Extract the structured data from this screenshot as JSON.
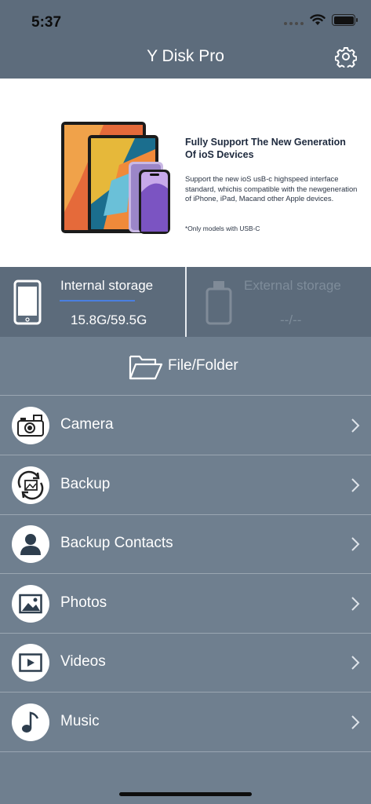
{
  "status_bar": {
    "time": "5:37"
  },
  "header": {
    "title": "Y Disk Pro"
  },
  "banner": {
    "heading": "Fully Support The New Generation Of ioS Devices",
    "body": "Support the new ioS usB-c highspeed interface standard, whichis compatible with the newgeneration of iPhone, iPad, Macand other Apple devices.",
    "note": "*Only models with USB-C"
  },
  "storage": {
    "internal": {
      "label": "Internal storage",
      "value": "15.8G/59.5G"
    },
    "external": {
      "label": "External storage",
      "value": "--/--"
    }
  },
  "file_folder": {
    "label": "File/Folder"
  },
  "menu": [
    {
      "label": "Camera",
      "icon": "camera-icon"
    },
    {
      "label": "Backup",
      "icon": "backup-icon"
    },
    {
      "label": "Backup Contacts",
      "icon": "contact-icon"
    },
    {
      "label": "Photos",
      "icon": "photo-icon"
    },
    {
      "label": "Videos",
      "icon": "video-icon"
    },
    {
      "label": "Music",
      "icon": "music-icon"
    }
  ],
  "colors": {
    "header_bg": "#5d6c7c",
    "body_bg": "#6f7f8f",
    "accent_bar": "#4a7fe0"
  }
}
